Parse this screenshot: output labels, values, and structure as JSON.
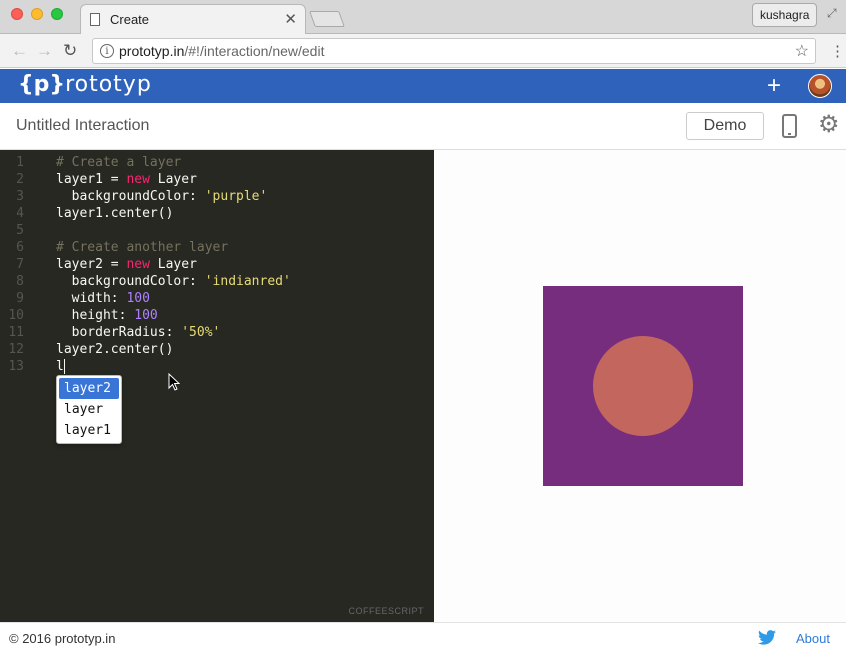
{
  "browser": {
    "tab_title": "Create",
    "tab_close": "✕",
    "profile_name": "kushagra",
    "url_host": "prototyp.in",
    "url_path": "/#!/interaction/new/edit",
    "info_icon": "i",
    "star_icon": "☆",
    "menu_icon": "⋮",
    "resize_icon": "⤢",
    "back_icon": "←",
    "forward_icon": "→",
    "reload_icon": "↻"
  },
  "app": {
    "logo_brace": "{p}",
    "logo_text": "rototyp",
    "plus_icon": "+",
    "accent_color": "#2f63bb"
  },
  "toolbar": {
    "title": "Untitled Interaction",
    "demo_label": "Demo",
    "gear_icon": "⚙"
  },
  "editor": {
    "language_label": "COFFEESCRIPT",
    "line_numbers": [
      "1",
      "2",
      "3",
      "4",
      "5",
      "6",
      "7",
      "8",
      "9",
      "10",
      "11",
      "12",
      "13"
    ],
    "lines": [
      [
        {
          "t": "cmt",
          "v": "# Create a layer"
        }
      ],
      [
        {
          "t": "",
          "v": "layer1 = "
        },
        {
          "t": "kw",
          "v": "new"
        },
        {
          "t": "",
          "v": " Layer"
        }
      ],
      [
        {
          "t": "",
          "v": "  backgroundColor: "
        },
        {
          "t": "str",
          "v": "'purple'"
        }
      ],
      [
        {
          "t": "",
          "v": "layer1.center()"
        }
      ],
      [],
      [
        {
          "t": "cmt",
          "v": "# Create another layer"
        }
      ],
      [
        {
          "t": "",
          "v": "layer2 = "
        },
        {
          "t": "kw",
          "v": "new"
        },
        {
          "t": "",
          "v": " Layer"
        }
      ],
      [
        {
          "t": "",
          "v": "  backgroundColor: "
        },
        {
          "t": "str",
          "v": "'indianred'"
        }
      ],
      [
        {
          "t": "",
          "v": "  width: "
        },
        {
          "t": "num",
          "v": "100"
        }
      ],
      [
        {
          "t": "",
          "v": "  height: "
        },
        {
          "t": "num",
          "v": "100"
        }
      ],
      [
        {
          "t": "",
          "v": "  borderRadius: "
        },
        {
          "t": "str",
          "v": "'50%'"
        }
      ],
      [
        {
          "t": "",
          "v": "layer2.center()"
        }
      ],
      [
        {
          "t": "",
          "v": "l"
        },
        {
          "t": "cursor",
          "v": ""
        }
      ]
    ],
    "autocomplete": {
      "items": [
        "layer2",
        "layer",
        "layer1"
      ],
      "selected_index": 0
    }
  },
  "preview": {
    "layer1_color": "#762d7e",
    "layer2_color": "#c3665e"
  },
  "footer": {
    "copyright": "© 2016 prototyp.in",
    "about_label": "About"
  }
}
